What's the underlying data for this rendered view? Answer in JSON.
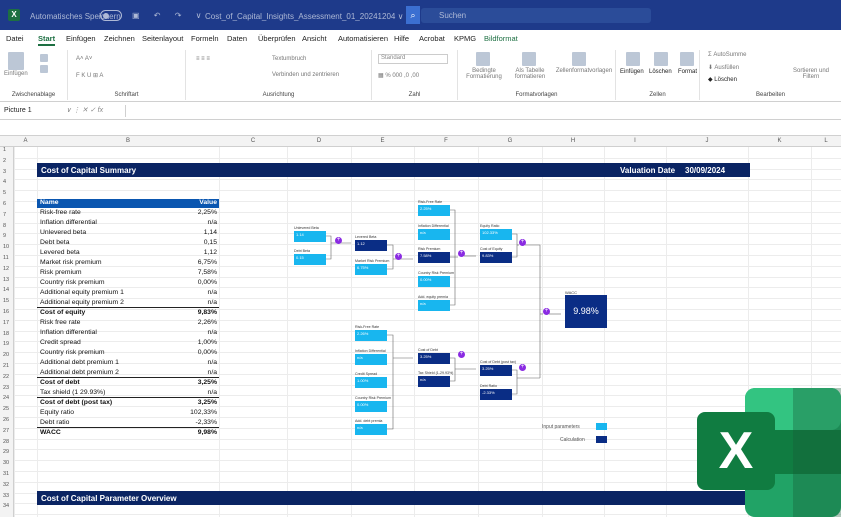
{
  "titlebar": {
    "autosave_label": "Automatisches Speichern",
    "filename": "Cost_of_Capital_Insights_Assessment_01_20241204 ∨",
    "search_placeholder": "Suchen"
  },
  "ribbon": {
    "tabs": [
      "Datei",
      "Start",
      "Einfügen",
      "Zeichnen",
      "Seitenlayout",
      "Formeln",
      "Daten",
      "Überprüfen",
      "Ansicht",
      "Automatisieren",
      "Hilfe",
      "Acrobat",
      "KPMG",
      "Bildformat"
    ],
    "active_tab": "Start",
    "groups": {
      "clipboard": "Zwischenablage",
      "font": "Schriftart",
      "alignment": "Ausrichtung",
      "number": "Zahl",
      "styles": "Formatvorlagen",
      "cells": "Zellen",
      "editing": "Bearbeiten"
    },
    "buttons": {
      "paste": "Einfügen",
      "wrap_text": "Textumbruch",
      "merge": "Verbinden und zentrieren",
      "number_format": "Standard",
      "cond_format": "Bedingte Formatierung",
      "as_table": "Als Tabelle formatieren",
      "cell_styles": "Zellenformatvorlagen",
      "insert": "Einfügen",
      "delete": "Löschen",
      "format": "Format",
      "autosum": "AutoSumme",
      "fill": "Ausfüllen",
      "clear": "Löschen",
      "sort_filter": "Sortieren und Filtern"
    }
  },
  "formula_bar": {
    "name_box": "Picture 1",
    "fx": "fx"
  },
  "columns": [
    "A",
    "B",
    "C",
    "D",
    "E",
    "F",
    "G",
    "H",
    "I",
    "J",
    "K",
    "L"
  ],
  "rows": [
    "1",
    "2",
    "3",
    "4",
    "5",
    "6",
    "7",
    "8",
    "9",
    "10",
    "11",
    "12",
    "13",
    "14",
    "15",
    "16",
    "17",
    "18",
    "19",
    "20",
    "21",
    "22",
    "23",
    "24",
    "25",
    "26",
    "27",
    "28",
    "29",
    "30",
    "31",
    "32",
    "33",
    "34"
  ],
  "sheet": {
    "title": "Cost of Capital Summary",
    "valuation_date_label": "Valuation Date",
    "valuation_date": "30/09/2024",
    "footer_title": "Cost of Capital Parameter Overview",
    "table_header": {
      "name": "Name",
      "value": "Value"
    },
    "table_rows": [
      {
        "name": "Risk-free rate",
        "value": "2,25%"
      },
      {
        "name": "Inflation differential",
        "value": "n/a"
      },
      {
        "name": "Unlevered beta",
        "value": "1,14"
      },
      {
        "name": "Debt beta",
        "value": "0,15"
      },
      {
        "name": "Levered beta",
        "value": "1,12"
      },
      {
        "name": "Market risk premium",
        "value": "6,75%"
      },
      {
        "name": "Risk premium",
        "value": "7,58%"
      },
      {
        "name": "Country risk premium",
        "value": "0,00%"
      },
      {
        "name": "Additional equity premium 1",
        "value": "n/a"
      },
      {
        "name": "Additional equity premium 2",
        "value": "n/a"
      },
      {
        "name": "Cost of equity",
        "value": "9,83%"
      },
      {
        "name": "Risk free rate",
        "value": "2,26%"
      },
      {
        "name": "Inflation differential",
        "value": "n/a"
      },
      {
        "name": "Credit spread",
        "value": "1,00%"
      },
      {
        "name": "Country risk premium",
        "value": "0,00%"
      },
      {
        "name": "Additional debt premium 1",
        "value": "n/a"
      },
      {
        "name": "Additional debt premium 2",
        "value": "n/a"
      },
      {
        "name": "Cost of debt",
        "value": "3,25%"
      },
      {
        "name": "Tax shield (1 29.93%)",
        "value": "n/a"
      },
      {
        "name": "Cost of debt (post tax)",
        "value": "3,25%"
      },
      {
        "name": "Equity ratio",
        "value": "102,33%"
      },
      {
        "name": "Debt ratio",
        "value": "-2,33%"
      },
      {
        "name": "WACC",
        "value": "9,98%"
      }
    ]
  },
  "diagram": {
    "boxes": [
      {
        "id": "unlevered",
        "label": "Unlevered Beta",
        "value": "1.14",
        "kind": "in"
      },
      {
        "id": "debtbeta",
        "label": "Debt Beta",
        "value": "0.15",
        "kind": "in"
      },
      {
        "id": "levered",
        "label": "Levered Beta",
        "value": "1.12",
        "kind": "calc"
      },
      {
        "id": "mrp",
        "label": "Market Risk Premium",
        "value": "6.75%",
        "kind": "in"
      },
      {
        "id": "rf1",
        "label": "Risk-Free Rate",
        "value": "2.25%",
        "kind": "in"
      },
      {
        "id": "infl1",
        "label": "Inflation Differential",
        "value": "n/a",
        "kind": "in"
      },
      {
        "id": "riskprem",
        "label": "Risk Premium",
        "value": "7.58%",
        "kind": "calc"
      },
      {
        "id": "crp1",
        "label": "Country Risk Premium",
        "value": "0.00%",
        "kind": "in"
      },
      {
        "id": "addeq",
        "label": "Add. equity premia",
        "value": "n/a",
        "kind": "in"
      },
      {
        "id": "eqratio",
        "label": "Equity Ratio",
        "value": "102.33%",
        "kind": "in"
      },
      {
        "id": "coe",
        "label": "Cost of Equity",
        "value": "9.83%",
        "kind": "calc"
      },
      {
        "id": "rf2",
        "label": "Risk-Free Rate",
        "value": "2.26%",
        "kind": "in"
      },
      {
        "id": "infl2",
        "label": "Inflation Differential",
        "value": "n/a",
        "kind": "in"
      },
      {
        "id": "credit",
        "label": "Credit Spread",
        "value": "1.00%",
        "kind": "in"
      },
      {
        "id": "crp2",
        "label": "Country Risk Premium",
        "value": "0.00%",
        "kind": "in"
      },
      {
        "id": "adddebt",
        "label": "Add. debt premia",
        "value": "n/a",
        "kind": "in"
      },
      {
        "id": "cod",
        "label": "Cost of Debt",
        "value": "3.25%",
        "kind": "calc"
      },
      {
        "id": "taxshield",
        "label": "Tax Shield (1-29.93%)",
        "value": "n/a",
        "kind": "calc"
      },
      {
        "id": "codpt",
        "label": "Cost of Debt (post tax)",
        "value": "3.25%",
        "kind": "calc"
      },
      {
        "id": "debtratio",
        "label": "Debt Ratio",
        "value": "-2.33%",
        "kind": "calc"
      }
    ],
    "wacc_label": "WACC",
    "wacc_value": "9.98%",
    "legend_input": "Input parameters",
    "legend_calc": "Calculation"
  },
  "colors": {
    "band": "#0a2463",
    "input": "#18b6ef",
    "calc": "#0a2d85",
    "node": "#8a2be2",
    "excel": "#1d6f42"
  }
}
